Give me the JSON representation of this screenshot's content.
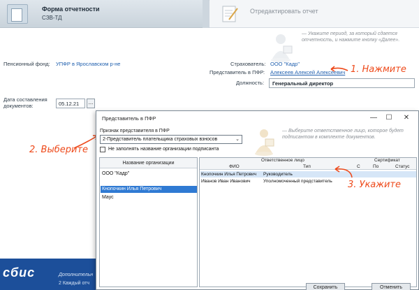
{
  "wizard": {
    "step1_title": "Форма отчетности",
    "step1_subtitle": "СЗВ-ТД",
    "step2_title": "Отредактировать отчет"
  },
  "hint_text": "— Укажите период, за который сдается отчетность, и нажмите кнопку «Далее».",
  "form": {
    "pension_fund_label": "Пенсионный фонд:",
    "pension_fund_value": "УПФР в Ярославском р-не",
    "insurer_label": "Страхователь:",
    "insurer_value": "ООО \"Кадр\"",
    "pfr_rep_label": "Представитель в ПФР:",
    "pfr_rep_value": "Алексеев Алексей Алексеевич",
    "position_label": "Должность:",
    "position_value": "Генеральный директор",
    "date_label_line1": "Дата составления",
    "date_label_line2": "документов:",
    "date_value": "05.12.21",
    "date_button": "..."
  },
  "annotations": {
    "a1": "1. Нажмите",
    "a2": "2. Выберите",
    "a3": "3. Укажите"
  },
  "dialog": {
    "title": "Представитель в ПФР",
    "minimize": "—",
    "maximize": "☐",
    "close": "✕",
    "sign_label": "Признак представителя в ПФР",
    "sign_value": "2-Представитель плательщика страховых взносов",
    "checkbox_label": "Не заполнять название организации подписанта",
    "hint": "— Выберите ответственное лицо, которое будет подписантом в комплекте документов.",
    "org_header": "Название организации",
    "orgs": [
      {
        "label": "ООО \"Кадр\"",
        "selected": false
      },
      {
        "label": "Кнопочкин Илья Петрович",
        "selected": true
      },
      {
        "label": "Маус",
        "selected": false
      }
    ],
    "people_header": "Ответственное лицо",
    "col_fio": "ФИО",
    "col_type": "Тип",
    "cert_header": "Сертификат",
    "col_c": "С",
    "col_po": "По",
    "col_status": "Статус",
    "people": [
      {
        "fio": "Кнопочкин Илья Петрович",
        "type": "Руководитель",
        "selected": true
      },
      {
        "fio": "Иванов Иван Иванович",
        "type": "Уполномоченный представитель",
        "selected": false
      }
    ],
    "save_button": "Сохранить",
    "cancel_button": "Отменить"
  },
  "footer": {
    "logo": "сбис",
    "line1": "Дополнительн",
    "line2": "2 Каждый отч"
  },
  "colors": {
    "accent": "#ee4a1b",
    "link": "#1f5fae",
    "selection": "#2f7ad3",
    "footer": "#1c4f9a"
  }
}
